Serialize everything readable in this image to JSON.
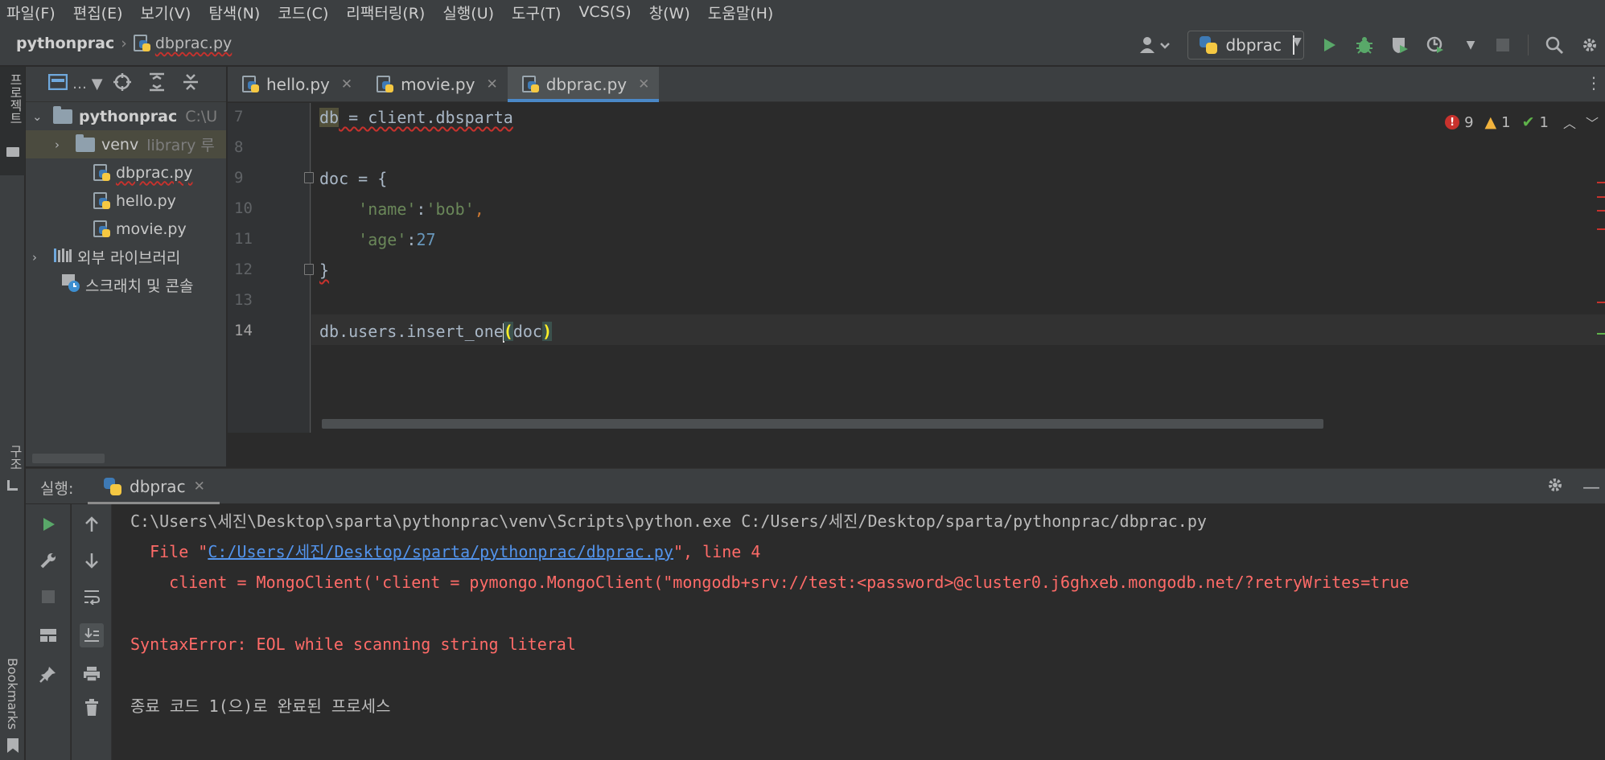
{
  "menu": [
    "파일(F)",
    "편집(E)",
    "보기(V)",
    "탐색(N)",
    "코드(C)",
    "리팩터링(R)",
    "실행(U)",
    "도구(T)",
    "VCS(S)",
    "창(W)",
    "도움말(H)"
  ],
  "breadcrumb": {
    "project": "pythonprac",
    "file": "dbprac.py"
  },
  "toolbar": {
    "run_config": "dbprac"
  },
  "left_strip": {
    "project_label": "프로젝트",
    "structure_label": "구조",
    "bookmarks_label": "Bookmarks"
  },
  "project_tree": {
    "root": {
      "name": "pythonprac",
      "path": "C:\\U"
    },
    "venv": {
      "name": "venv",
      "note": "library 루"
    },
    "files": [
      "dbprac.py",
      "hello.py",
      "movie.py"
    ],
    "external_libraries": "외부 라이브러리",
    "scratches": "스크래치 및 콘솔"
  },
  "editor_tabs": [
    {
      "label": "hello.py",
      "active": false
    },
    {
      "label": "movie.py",
      "active": false
    },
    {
      "label": "dbprac.py",
      "active": true
    }
  ],
  "editor": {
    "line_numbers": [
      "7",
      "8",
      "9",
      "10",
      "11",
      "12",
      "13",
      "14"
    ],
    "line7": {
      "var": "db",
      "rest": " = client.dbsparta"
    },
    "line9": "doc = {",
    "line10": {
      "key": "'name'",
      "colon": ":",
      "val": "'bob'",
      "comma": ","
    },
    "line11": {
      "key": "'age'",
      "colon": ":",
      "val": "27"
    },
    "line12": "}",
    "line14": {
      "pre": "db.users.insert_one",
      "open": "(",
      "arg": "doc",
      "close": ")"
    },
    "inspections": {
      "errors": "9",
      "warnings": "1",
      "ok": "1"
    }
  },
  "run_panel": {
    "label": "실행:",
    "tab": "dbprac",
    "console": {
      "cmd": "C:\\Users\\세진\\Desktop\\sparta\\pythonprac\\venv\\Scripts\\python.exe C:/Users/세진/Desktop/sparta/pythonprac/dbprac.py",
      "file_prefix": "  File \"",
      "file_link": "C:/Users/세진/Desktop/sparta/pythonprac/dbprac.py",
      "file_suffix": "\", line 4",
      "client_line": "    client = MongoClient('client = pymongo.MongoClient(\"mongodb+srv://test:<password>@cluster0.j6ghxeb.mongodb.net/?retryWrites=true",
      "error": "SyntaxError: EOL while scanning string literal",
      "exit": "종료 코드 1(으)로 완료된 프로세스"
    }
  },
  "colors": {
    "error": "#ff6b68",
    "link": "#5394ec",
    "run_green": "#59a869",
    "accent_tab": "#4a88c7"
  }
}
